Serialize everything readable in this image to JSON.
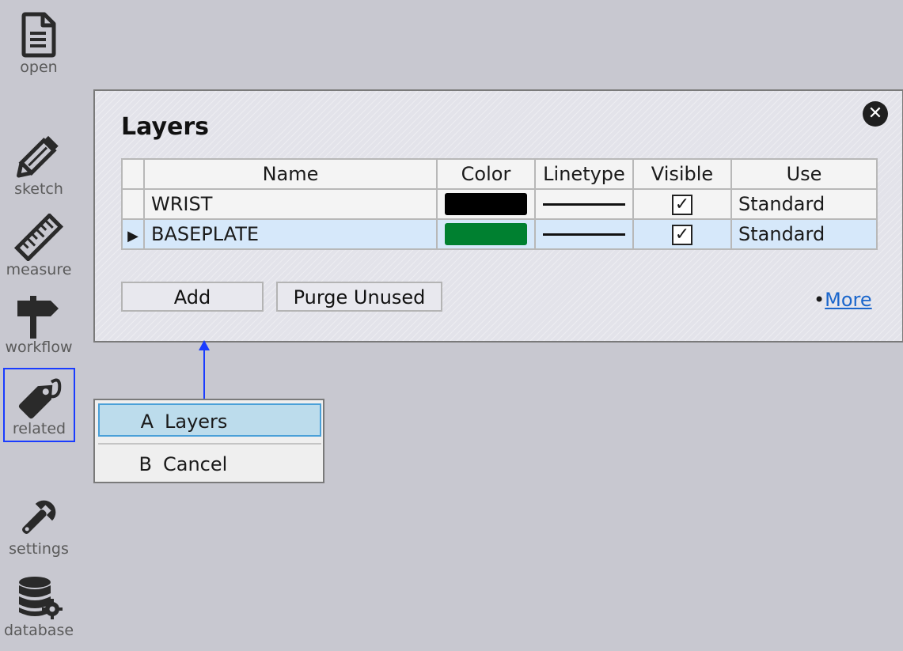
{
  "sidebar": {
    "items": [
      {
        "id": "open",
        "label": "open",
        "icon": "document-icon"
      },
      {
        "id": "sketch",
        "label": "sketch",
        "icon": "pencil-icon"
      },
      {
        "id": "measure",
        "label": "measure",
        "icon": "ruler-icon"
      },
      {
        "id": "workflow",
        "label": "workflow",
        "icon": "signpost-icon"
      },
      {
        "id": "related",
        "label": "related",
        "icon": "tag-icon",
        "active": true
      },
      {
        "id": "settings",
        "label": "settings",
        "icon": "wrench-icon"
      },
      {
        "id": "database",
        "label": "database",
        "icon": "database-gear-icon"
      }
    ]
  },
  "panel": {
    "title": "Layers",
    "close_icon": "close-icon",
    "columns": [
      "Name",
      "Color",
      "Linetype",
      "Visible",
      "Use"
    ],
    "rows": [
      {
        "name": "WRIST",
        "color": "#000000",
        "visible": true,
        "use": "Standard",
        "selected": false
      },
      {
        "name": "BASEPLATE",
        "color": "#008030",
        "visible": true,
        "use": "Standard",
        "selected": true
      }
    ],
    "check_mark": "✓",
    "add_label": "Add",
    "purge_label": "Purge Unused",
    "more_bullet": "•",
    "more_label": "More"
  },
  "menu": {
    "items": [
      {
        "key": "A",
        "label": "Layers",
        "highlighted": true
      },
      {
        "key": "B",
        "label": "Cancel",
        "highlighted": false
      }
    ]
  },
  "colors": {
    "accent": "#1a3cff",
    "selection": "#d6e8fa",
    "link": "#1a66cc"
  }
}
